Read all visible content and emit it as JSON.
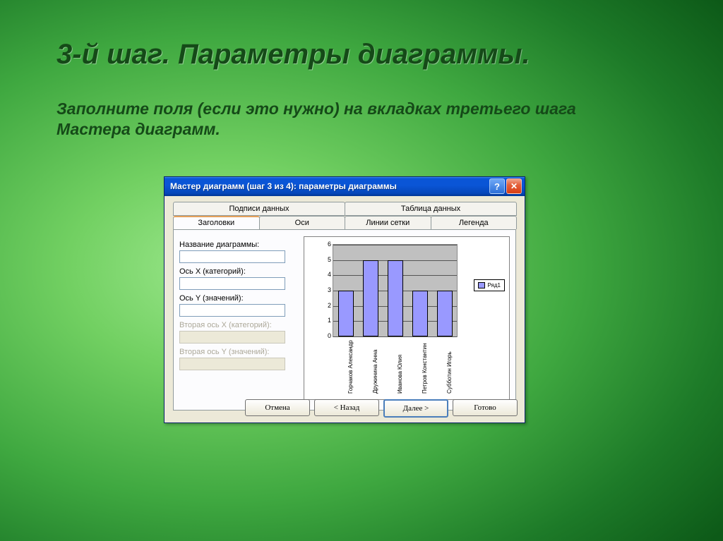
{
  "slide": {
    "title": "3-й шаг. Параметры диаграммы.",
    "subtitle": "Заполните поля (если это нужно) на вкладках третьего шага Мастера диаграмм."
  },
  "dialog": {
    "title": "Мастер диаграмм (шаг 3 из 4): параметры диаграммы",
    "tabs_row1": [
      "Подписи данных",
      "Таблица данных"
    ],
    "tabs_row2": [
      "Заголовки",
      "Оси",
      "Линии сетки",
      "Легенда"
    ],
    "active_tab": "Заголовки",
    "fields": {
      "chart_title": "Название диаграммы:",
      "x_axis": "Ось X (категорий):",
      "y_axis": "Ось Y (значений):",
      "x2_axis": "Вторая ось X (категорий):",
      "y2_axis": "Вторая ось Y (значений):"
    },
    "buttons": {
      "cancel": "Отмена",
      "back": "< Назад",
      "next": "Далее >",
      "finish": "Готово"
    }
  },
  "chart_data": {
    "type": "bar",
    "categories": [
      "Горчаков Александр",
      "Дружинина Анна",
      "Иванова Юлия",
      "Петров Константин",
      "Субботин Игорь"
    ],
    "values": [
      3,
      5,
      5,
      3,
      3
    ],
    "ylim": [
      0,
      6
    ],
    "yticks": [
      0,
      1,
      2,
      3,
      4,
      5,
      6
    ],
    "legend": "Ряд1",
    "bar_color": "#9999ff"
  }
}
